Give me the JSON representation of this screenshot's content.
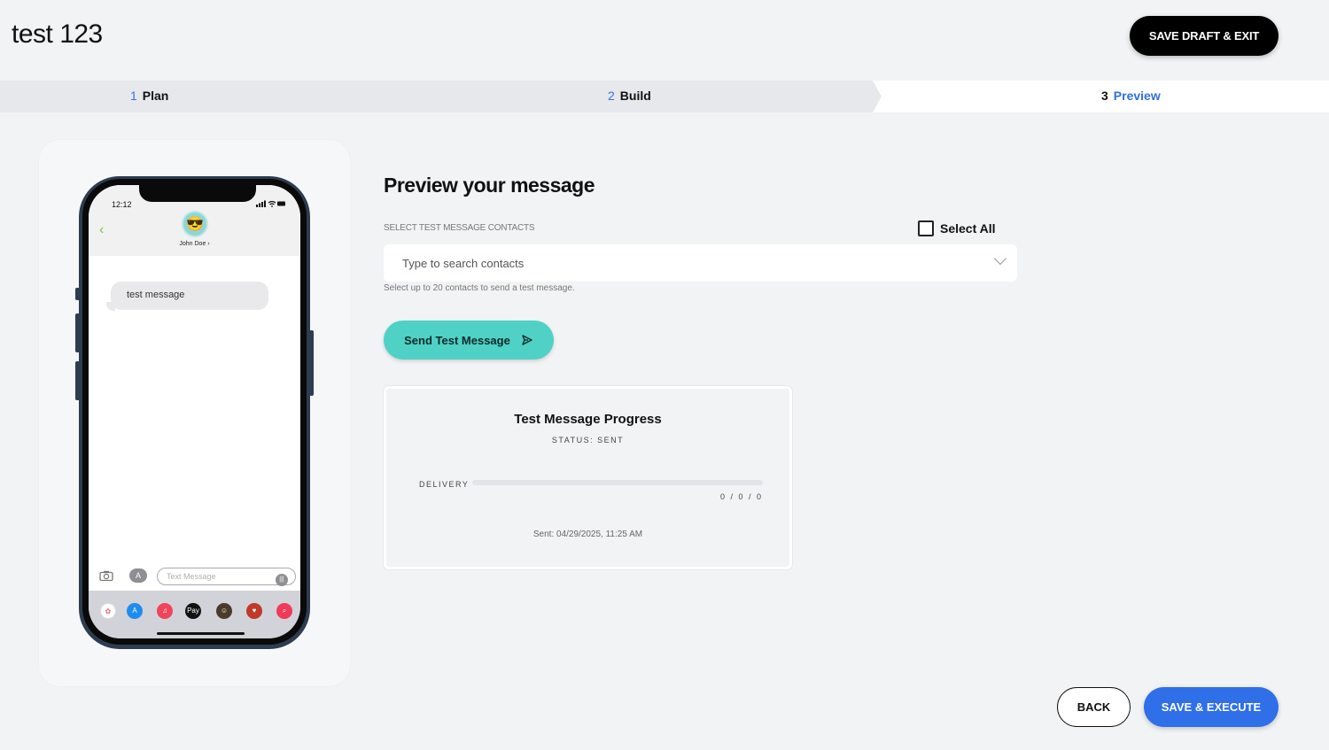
{
  "header": {
    "title": "test 123",
    "save_draft_label": "SAVE DRAFT & EXIT"
  },
  "stepper": {
    "steps": [
      {
        "num": "1",
        "label": "Plan"
      },
      {
        "num": "2",
        "label": "Build"
      },
      {
        "num": "3",
        "label": "Preview"
      }
    ],
    "active": 3
  },
  "phone": {
    "time": "12:12",
    "status_icons": "signal-icon wifi-icon battery-icon",
    "contact_name": "John Doe",
    "message": "test message",
    "input_placeholder": "Text Message"
  },
  "preview": {
    "heading": "Preview your message",
    "field_label": "SELECT TEST MESSAGE CONTACTS",
    "select_all_label": "Select All",
    "search_placeholder": "Type to search contacts",
    "helper_text": "Select up to 20 contacts to send a test message.",
    "send_button_label": "Send Test Message"
  },
  "progress": {
    "title": "Test Message Progress",
    "status": "STATUS: SENT",
    "delivery_label": "DELIVERY",
    "delivery_fraction": 0,
    "counts": "0 / 0 / 0",
    "sent_at": "Sent: 04/29/2025, 11:25 AM"
  },
  "footer": {
    "back_label": "BACK",
    "execute_label": "SAVE & EXECUTE"
  },
  "colors": {
    "accent_teal": "#4fd1c5",
    "primary_blue": "#2f6fe8",
    "dark": "#000000"
  }
}
